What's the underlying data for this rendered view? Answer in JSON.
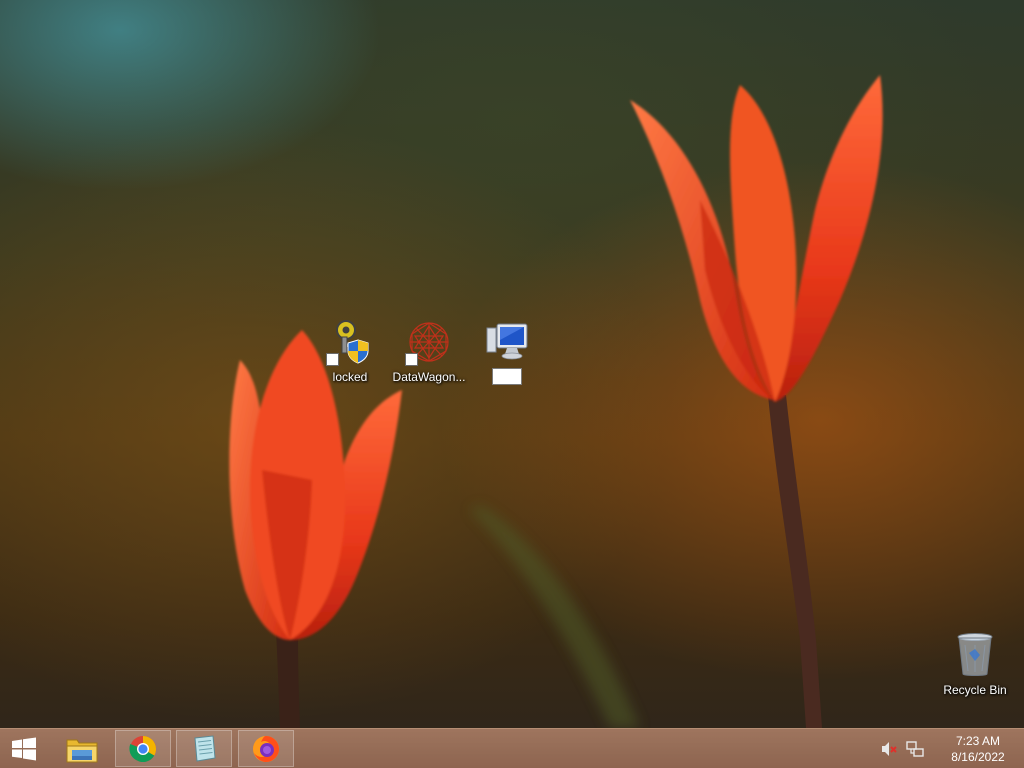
{
  "desktop": {
    "icons": [
      {
        "label": "locked",
        "icon": "keys-lock-shield-icon"
      },
      {
        "label": "DataWagon...",
        "icon": "red-network-sphere-icon"
      },
      {
        "label": "",
        "icon": "computer-icon",
        "renaming": true,
        "rename_value": ""
      },
      {
        "label": "Recycle Bin",
        "icon": "recycle-bin-icon"
      }
    ]
  },
  "taskbar": {
    "start": {
      "icon": "windows-logo-icon"
    },
    "pinned": [
      {
        "name": "File Explorer",
        "icon": "file-explorer-icon",
        "running": false
      },
      {
        "name": "Google Chrome",
        "icon": "chrome-icon",
        "running": true
      },
      {
        "name": "Notepad",
        "icon": "notepad-icon",
        "running": true
      },
      {
        "name": "Firefox",
        "icon": "firefox-icon",
        "running": true
      }
    ],
    "tray": {
      "icons": [
        "speaker-muted-icon",
        "network-icon"
      ],
      "time": "7:23 AM",
      "date": "8/16/2022"
    }
  },
  "colors": {
    "tulip": "#e8431c",
    "taskbar": "#8f5f48"
  }
}
